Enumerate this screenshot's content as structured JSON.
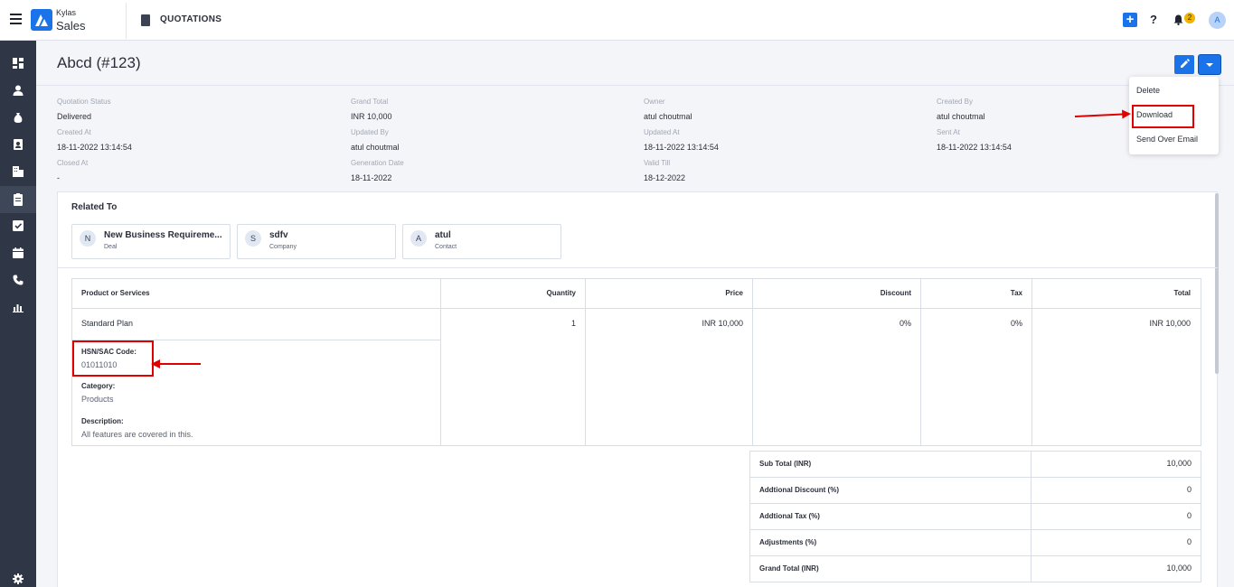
{
  "app": {
    "brand_top": "Kylas",
    "brand_bottom": "Sales",
    "module_title": "QUOTATIONS",
    "notification_count": "2",
    "avatar_letter": "A"
  },
  "header": {
    "title": "Abcd (#123)"
  },
  "details": [
    {
      "label": "Quotation Status",
      "value": "Delivered"
    },
    {
      "label": "Grand Total",
      "value": "INR 10,000"
    },
    {
      "label": "Owner",
      "value": "atul choutmal"
    },
    {
      "label": "Created By",
      "value": "atul choutmal"
    },
    {
      "label": "Created At",
      "value": "18-11-2022 13:14:54"
    },
    {
      "label": "Updated By",
      "value": "atul choutmal"
    },
    {
      "label": "Updated At",
      "value": "18-11-2022 13:14:54"
    },
    {
      "label": "Sent At",
      "value": "18-11-2022 13:14:54"
    },
    {
      "label": "Closed At",
      "value": "-"
    },
    {
      "label": "Generation Date",
      "value": "18-11-2022"
    },
    {
      "label": "Valid Till",
      "value": "18-12-2022"
    }
  ],
  "menu": {
    "items": [
      "Delete",
      "Download",
      "Send Over Email"
    ]
  },
  "related": {
    "title": "Related To",
    "entities": [
      {
        "initial": "N",
        "name": "New Business Requirement",
        "display_name": "New Business Requireme...",
        "type": "Deal"
      },
      {
        "initial": "S",
        "name": "sdfv",
        "type": "Company"
      },
      {
        "initial": "A",
        "name": "atul",
        "type": "Contact"
      }
    ]
  },
  "products": {
    "headers": [
      "Product or Services",
      "Quantity",
      "Price",
      "Discount",
      "Tax",
      "Total"
    ],
    "rows": [
      {
        "name": "Standard Plan",
        "quantity": "1",
        "price": "INR 10,000",
        "discount": "0%",
        "tax": "0%",
        "total": "INR 10,000",
        "hsn_label": "HSN/SAC Code:",
        "hsn_value": "01011010",
        "category_label": "Category:",
        "category_value": "Products",
        "description_label": "Description:",
        "description_value": "All features are covered in this."
      }
    ]
  },
  "totals": [
    {
      "label": "Sub Total (INR)",
      "value": "10,000"
    },
    {
      "label": "Addtional Discount (%)",
      "value": "0"
    },
    {
      "label": "Addtional Tax (%)",
      "value": "0"
    },
    {
      "label": "Adjustments (%)",
      "value": "0"
    },
    {
      "label": "Grand Total (INR)",
      "value": "10,000"
    }
  ],
  "colors": {
    "accent": "#1a73e8",
    "sidebar": "#2f3746",
    "annotation": "#e00000",
    "badge": "#f0b400"
  },
  "icons": [
    "menu-icon",
    "logo-icon",
    "quotation-icon",
    "plus-icon",
    "help-icon",
    "bell-icon",
    "edit-icon",
    "caret-down-icon",
    "settings-icon"
  ]
}
